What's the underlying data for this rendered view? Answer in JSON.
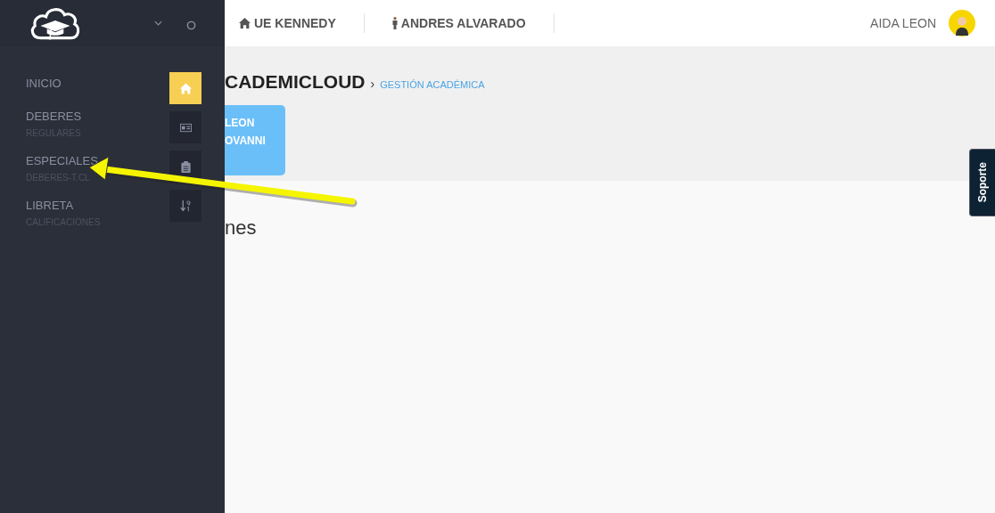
{
  "header": {
    "nav": [
      {
        "kind": "home",
        "label": "UE KENNEDY"
      },
      {
        "kind": "person",
        "label": "ANDRES ALVARADO"
      }
    ],
    "user": "AIDA LEON"
  },
  "sidebar": {
    "menu": [
      {
        "label": "INICIO"
      },
      {
        "label": "DEBERES",
        "sublabel": "REGULARES"
      },
      {
        "label": "ESPECIALES",
        "sublabel": "DEBERES-T.CL"
      },
      {
        "label": "LIBRETA",
        "sublabel": "CALIFICACIONES"
      }
    ],
    "icons": [
      {
        "kind": "home",
        "selected": true
      },
      {
        "kind": "card",
        "selected": false
      },
      {
        "kind": "clipboard",
        "selected": false
      },
      {
        "kind": "sort",
        "selected": false
      }
    ]
  },
  "page": {
    "title": "CADEMICLOUD",
    "breadcrumb_separator": "›",
    "breadcrumb": "GESTIÓN ACADÉMICA",
    "card_lines": [
      "LEON",
      "OVANNI"
    ],
    "heading": "nes"
  },
  "support_tab": "Soporte"
}
